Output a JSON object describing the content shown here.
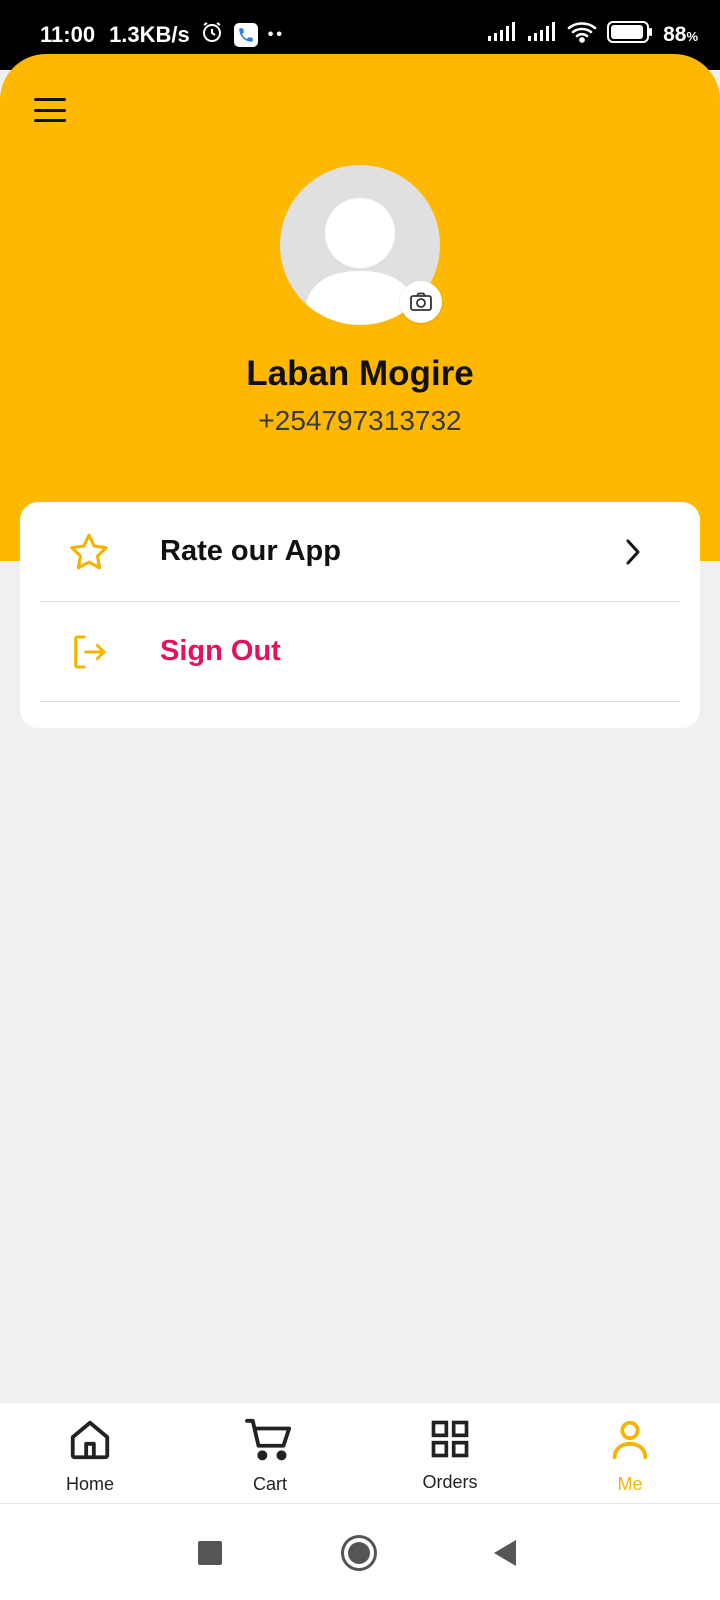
{
  "status_bar": {
    "time": "11:00",
    "speed": "1.3KB/s",
    "battery": "88",
    "battery_unit": "%",
    "icons": [
      "alarm-icon",
      "phone-app-icon",
      "signal-icon",
      "signal-icon",
      "wifi-icon",
      "battery-icon"
    ]
  },
  "header": {
    "menu_icon": "hamburger-menu-icon",
    "background_color": "#FFB800"
  },
  "profile": {
    "name": "Laban Mogire",
    "phone": "+254797313732",
    "avatar_icon": "user-avatar-icon",
    "camera_icon": "camera-icon"
  },
  "menu": {
    "items": [
      {
        "label": "Rate our App",
        "icon": "star-icon",
        "trailing_icon": "chevron-right-icon"
      },
      {
        "label": "Sign Out",
        "icon": "sign-out-icon",
        "color": "#E5105E"
      }
    ]
  },
  "bottom_nav": {
    "items": [
      {
        "label": "Home",
        "icon": "home-icon",
        "active": false
      },
      {
        "label": "Cart",
        "icon": "cart-icon",
        "active": false
      },
      {
        "label": "Orders",
        "icon": "grid-icon",
        "active": false
      },
      {
        "label": "Me",
        "icon": "user-icon",
        "active": true
      }
    ],
    "active_color": "#F4B400"
  },
  "system_nav": {
    "icons": [
      "recents-icon",
      "home-circle-icon",
      "back-icon"
    ]
  }
}
